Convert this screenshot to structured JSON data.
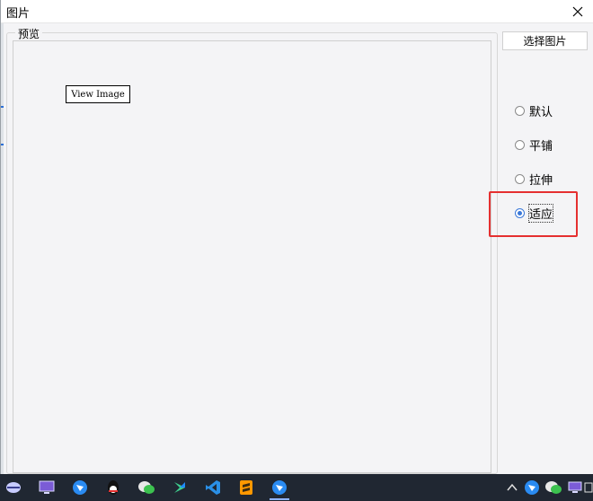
{
  "window": {
    "title": "图片",
    "close_icon": "close-icon"
  },
  "preview": {
    "group_label": "预览",
    "image_placeholder": "View Image"
  },
  "actions": {
    "select_image_label": "选择图片"
  },
  "display_mode": {
    "options": [
      {
        "label": "默认",
        "checked": false
      },
      {
        "label": "平铺",
        "checked": false
      },
      {
        "label": "拉伸",
        "checked": false
      },
      {
        "label": "适应",
        "checked": true
      }
    ]
  },
  "colors": {
    "highlight": "#e53030",
    "accent": "#3a78d8",
    "taskbar": "#202732"
  },
  "taskbar": {
    "left_icons": [
      "computer-icon",
      "feishu-icon",
      "qq-icon",
      "wechat-icon",
      "git-tool-icon",
      "vscode-icon",
      "sublime-icon",
      "feishu-active-icon"
    ],
    "tray_icons": [
      "chevron-up-icon",
      "feishu-tray-icon",
      "wechat-tray-icon",
      "display-tray-icon",
      "input-method-icon"
    ]
  }
}
